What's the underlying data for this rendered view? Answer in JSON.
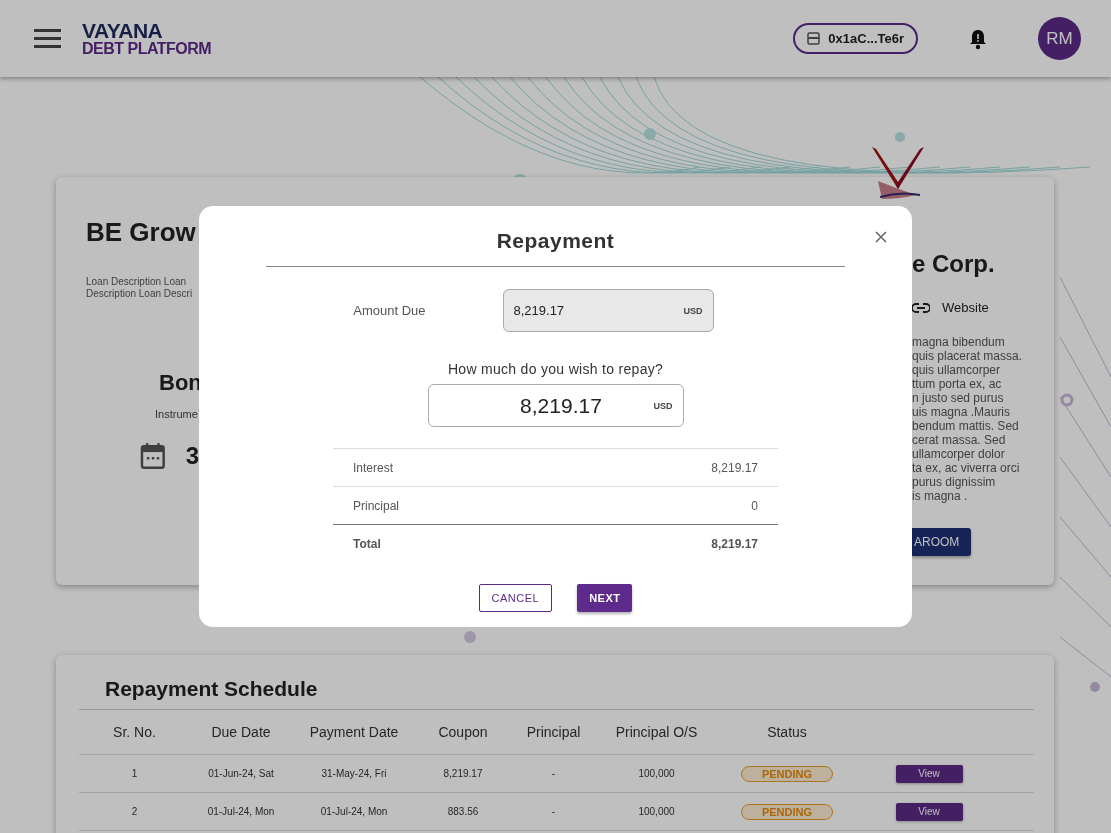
{
  "header": {
    "logo_top": "VAYANA",
    "logo_bottom": "DEBT PLATFORM",
    "wallet": "0x1aC...Te6r",
    "avatar": "RM"
  },
  "loan_card": {
    "title": "BE Grow",
    "description": "Loan Description Loan\nDescription Loan Descri",
    "instrument_title": "Bon",
    "instrument_label": "Instrume",
    "date_value": "3"
  },
  "company_card": {
    "name": "e Corp.",
    "website": "Website",
    "about": "magna bibendum\nquis placerat massa.\nquis ullamcorper\nttum porta ex, ac\nn justo sed purus\nuis magna .Mauris\nbendum mattis. Sed\ncerat massa. Sed\nullamcorper dolor\nta ex, ac viverra orci\npurus dignissim\nis magna .",
    "button": "AROOM"
  },
  "dialog": {
    "title": "Repayment",
    "amount_due_label": "Amount Due",
    "amount_due_value": "8,219.17",
    "amount_due_currency": "USD",
    "question": "How much do you wish to repay?",
    "repay_value": "8,219.17",
    "repay_currency": "USD",
    "breakdown": [
      {
        "label": "Interest",
        "value": "8,219.17",
        "total": false
      },
      {
        "label": "Principal",
        "value": "0",
        "total": false
      },
      {
        "label": "Total",
        "value": "8,219.17",
        "total": true
      }
    ],
    "buttons": [
      {
        "label": "CANCEL",
        "kind": "outlined"
      },
      {
        "label": "NEXT",
        "kind": "filled"
      }
    ]
  },
  "schedule": {
    "title": "Repayment Schedule",
    "columns": [
      "Sr. No.",
      "Due Date",
      "Payment Date",
      "Coupon",
      "Principal",
      "Principal O/S",
      "Status"
    ],
    "rows": [
      {
        "cells": [
          "1",
          "01-Jun-24, Sat",
          "31-May-24, Fri",
          "8,219.17",
          "-",
          "100,000"
        ],
        "status": "PENDING",
        "action": "View"
      },
      {
        "cells": [
          "2",
          "01-Jul-24, Mon",
          "01-Jul-24, Mon",
          "883.56",
          "-",
          "100,000"
        ],
        "status": "PENDING",
        "action": "View"
      }
    ]
  }
}
